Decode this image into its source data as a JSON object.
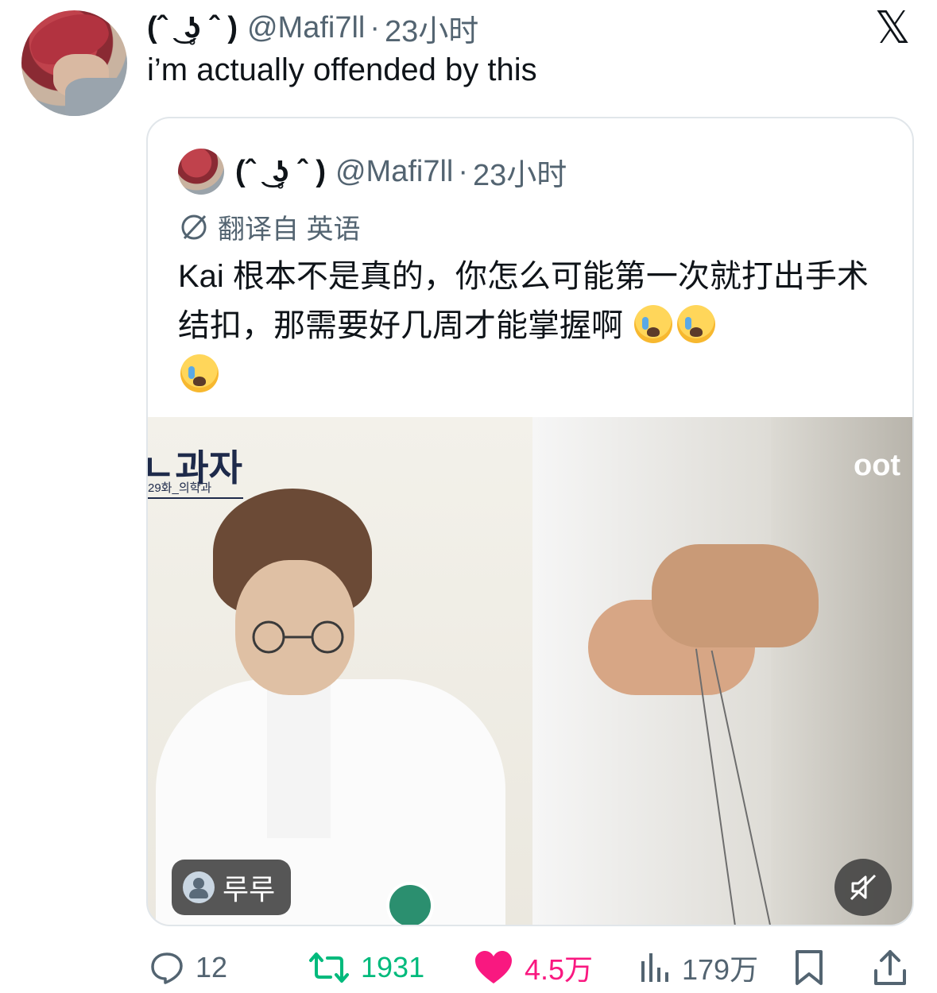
{
  "post": {
    "display_name": "(ˆ ͜ ʖ̥ ˆ )",
    "handle": "@Mafi7ll",
    "separator": "·",
    "time": "23小时",
    "text": "i’m actually offended by this"
  },
  "quoted": {
    "display_name": "(ˆ ͜ ʖ̥ ˆ )",
    "handle": "@Mafi7ll",
    "separator": "·",
    "time": "23小时",
    "translated_label": "翻译自 英语",
    "text": "Kai 根本不是真的，你怎么可能第一次就打出手术结扣，那需要好几周才能掌握啊",
    "media": {
      "left_overlay_title": "ㄴ과자",
      "left_overlay_sub": "29화_의학과",
      "right_overlay_text": "oot",
      "tag_label": "루루"
    }
  },
  "actions": {
    "reply_count": "12",
    "retweet_count": "1931",
    "like_count": "4.5万",
    "view_count": "179万"
  },
  "icons": {
    "brand": "x-logo-icon",
    "reply": "comment-icon",
    "retweet": "retweet-icon",
    "like": "heart-icon",
    "views": "bar-chart-icon",
    "bookmark": "bookmark-icon",
    "share": "share-icon",
    "translate": "translate-icon",
    "mute": "muted-speaker-icon"
  },
  "colors": {
    "text": "#0f1419",
    "secondary": "#536471",
    "retweet": "#00ba7c",
    "like": "#f91880",
    "border": "#e1e6ea"
  }
}
